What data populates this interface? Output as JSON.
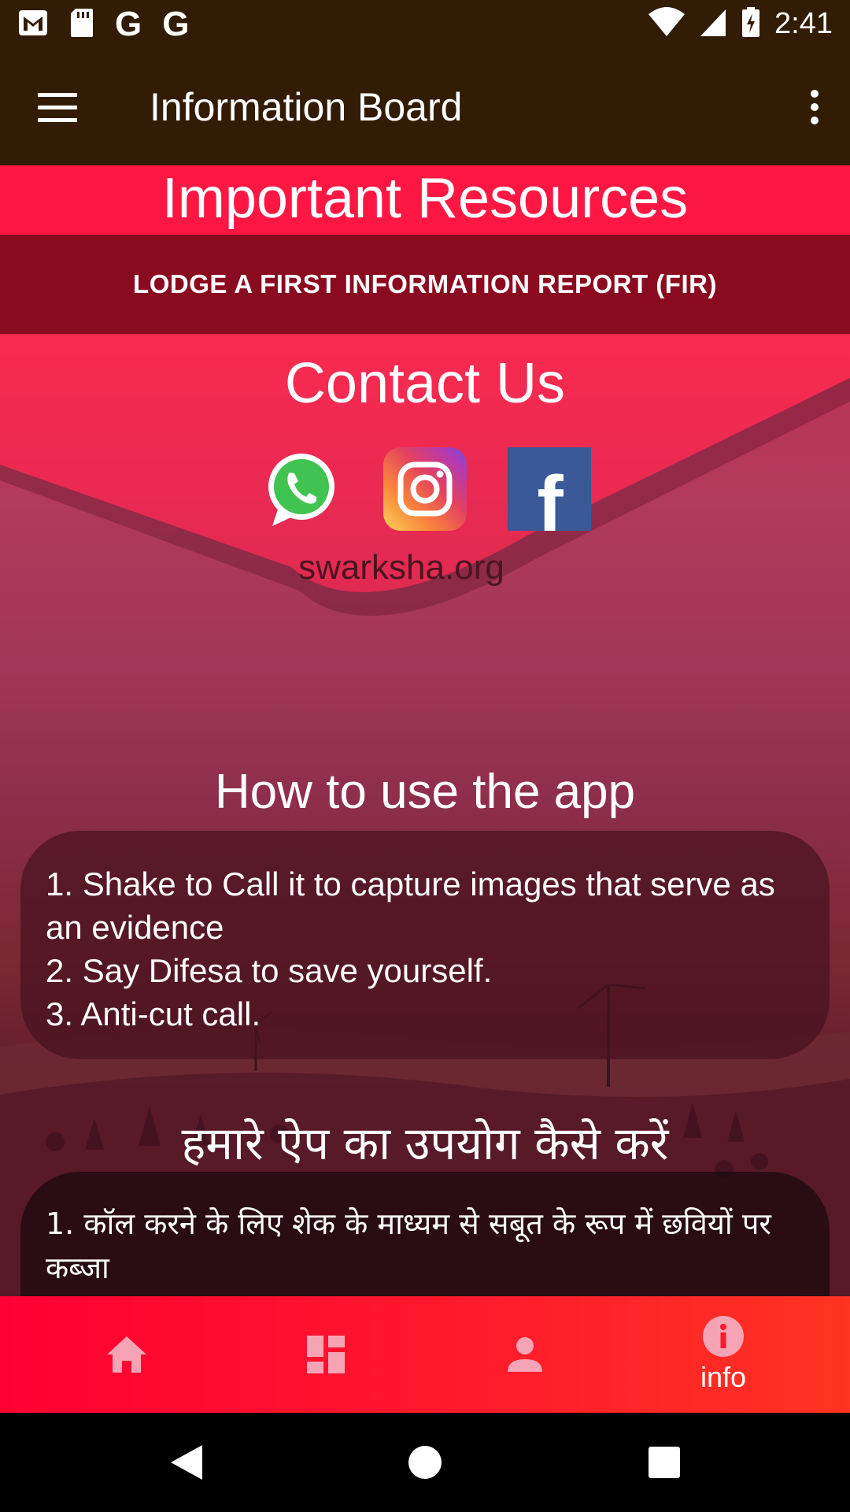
{
  "status_bar": {
    "time": "2:41",
    "notification_icons": [
      "gmail-icon",
      "sd-card-icon",
      "google-icon",
      "google-icon"
    ],
    "google_letter": "G"
  },
  "app_bar": {
    "title": "Information Board"
  },
  "banner": {
    "title": "Important Resources"
  },
  "fir": {
    "label": "LODGE A FIRST INFORMATION REPORT (FIR)"
  },
  "contact": {
    "title": "Contact Us",
    "social": [
      "whatsapp",
      "instagram",
      "facebook"
    ],
    "facebook_letter": "f",
    "website": "swarksha.org"
  },
  "howto": {
    "title": "How to use the app",
    "steps": [
      "1. Shake to Call it to capture images that serve as an evidence",
      "2. Say Difesa to save yourself.",
      "3. Anti-cut call."
    ]
  },
  "howto_hindi": {
    "title": "हमारे ऐप का उपयोग कैसे करें",
    "steps": [
      "1. कॉल करने के लिए शेक के माध्यम से सबूत के रूप में छवियों पर कब्जा"
    ]
  },
  "bottom_nav": {
    "items": [
      {
        "icon": "home-icon",
        "label": ""
      },
      {
        "icon": "dashboard-icon",
        "label": ""
      },
      {
        "icon": "person-icon",
        "label": ""
      },
      {
        "icon": "info-icon",
        "label": "info"
      }
    ],
    "active_index": 3
  },
  "colors": {
    "status_bar": "#331c05",
    "banner": "#ff1744",
    "fir_button": "#8a0b20",
    "bottom_nav": "#ff1a2c"
  }
}
